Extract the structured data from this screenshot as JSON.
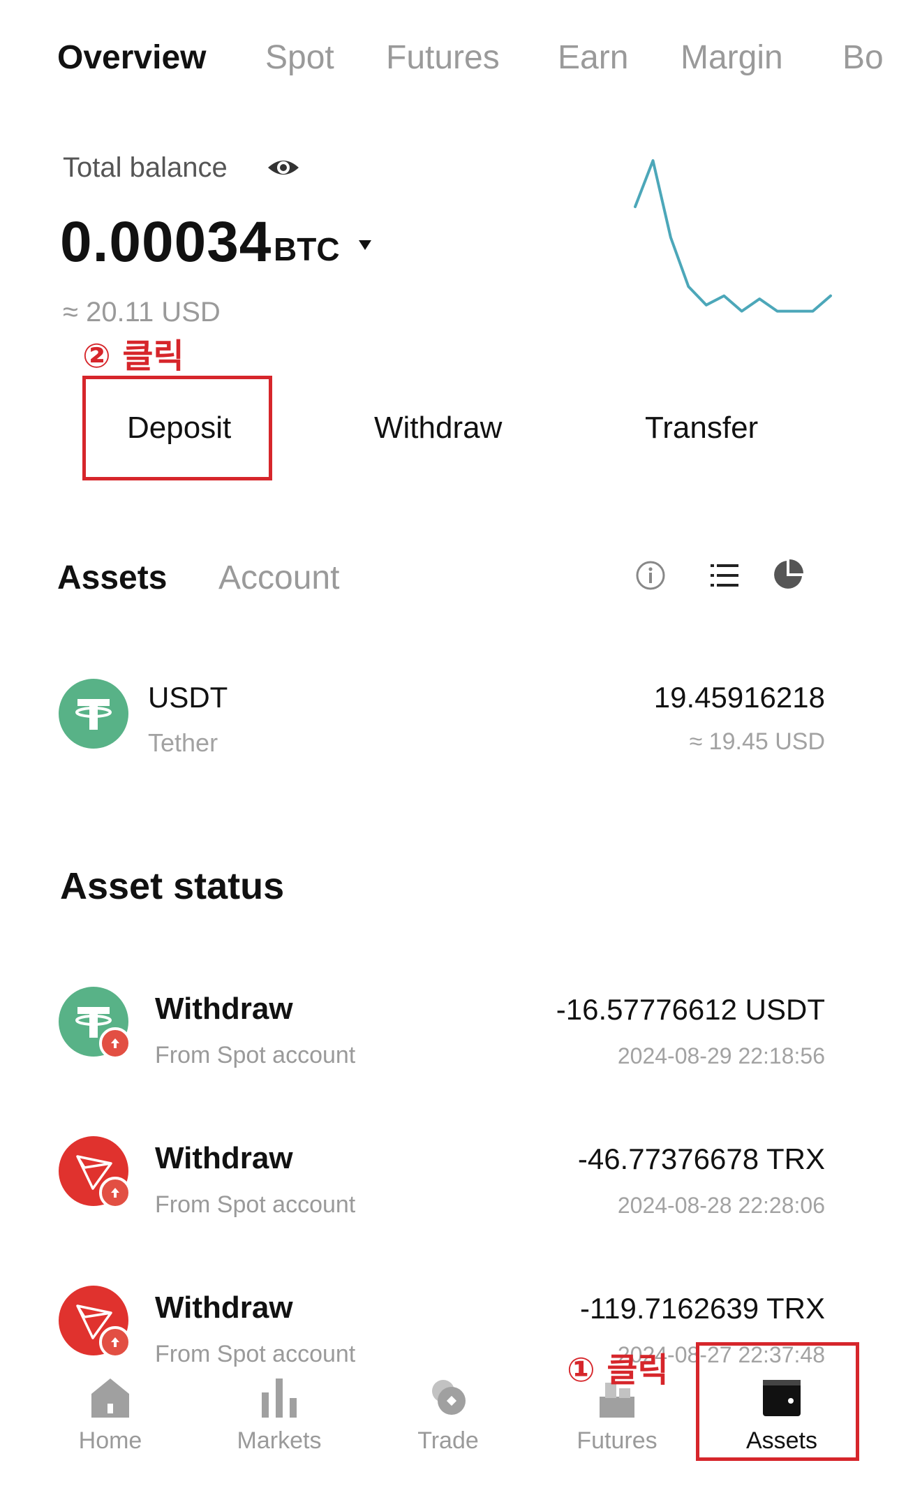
{
  "tabs": [
    "Overview",
    "Spot",
    "Futures",
    "Earn",
    "Margin",
    "Bo"
  ],
  "balance": {
    "label": "Total balance",
    "value": "0.00034",
    "unit": "BTC",
    "usd_approx": "≈ 20.11 USD",
    "sparkline": [
      0.7,
      1.0,
      0.5,
      0.18,
      0.06,
      0.12,
      0.02,
      0.1,
      0.02,
      0.02,
      0.02,
      0.12
    ]
  },
  "annotations": {
    "deposit_step": "② 클릭",
    "assets_step": "① 클릭"
  },
  "actions": {
    "deposit": "Deposit",
    "withdraw": "Withdraw",
    "transfer": "Transfer"
  },
  "subtabs": {
    "assets": "Assets",
    "account": "Account"
  },
  "asset": {
    "symbol": "USDT",
    "name": "Tether",
    "amount": "19.45916218",
    "usd": "≈ 19.45 USD"
  },
  "asset_status": {
    "title": "Asset status",
    "items": [
      {
        "type": "Withdraw",
        "source": "From Spot account",
        "amount": "-16.57776612 USDT",
        "time": "2024-08-29 22:18:56",
        "coin": "usdt-icon"
      },
      {
        "type": "Withdraw",
        "source": "From Spot account",
        "amount": "-46.77376678 TRX",
        "time": "2024-08-28 22:28:06",
        "coin": "trx-icon"
      },
      {
        "type": "Withdraw",
        "source": "From Spot account",
        "amount": "-119.7162639 TRX",
        "time": "2024-08-27 22:37:48",
        "coin": "trx-icon"
      }
    ]
  },
  "nav": {
    "home": "Home",
    "markets": "Markets",
    "trade": "Trade",
    "futures": "Futures",
    "assets": "Assets"
  },
  "colors": {
    "accent_red": "#d6262b",
    "usdt_green": "#58b287",
    "trx_red": "#e0322e",
    "sparkline": "#4ca7b9"
  }
}
